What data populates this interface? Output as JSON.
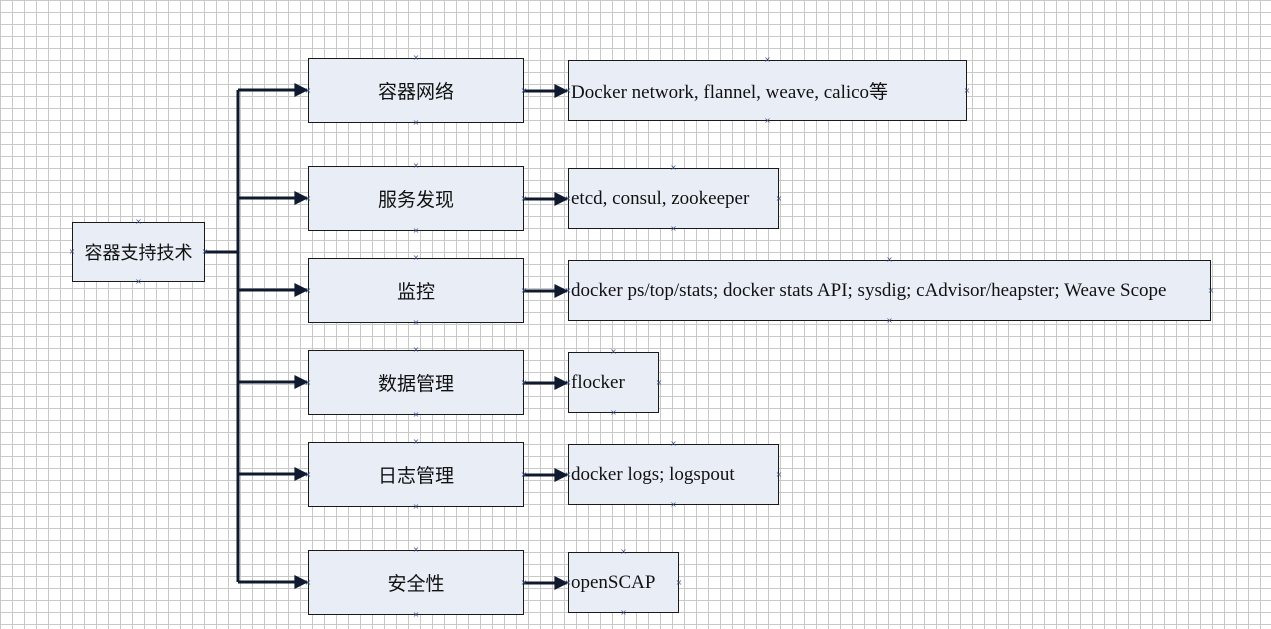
{
  "root": {
    "label": "容器支持技术"
  },
  "rows": [
    {
      "category": "容器网络",
      "tools": "Docker network, flannel, weave, calico等"
    },
    {
      "category": "服务发现",
      "tools": "etcd, consul, zookeeper"
    },
    {
      "category": "监控",
      "tools": "docker ps/top/stats; docker stats API; sysdig; cAdvisor/heapster; Weave Scope"
    },
    {
      "category": "数据管理",
      "tools": "flocker"
    },
    {
      "category": "日志管理",
      "tools": "docker logs; logspout"
    },
    {
      "category": "安全性",
      "tools": "openSCAP"
    }
  ],
  "colors": {
    "box_fill": "#e8edf6",
    "line": "#0f1a2e",
    "grid": "#c9c9c9"
  }
}
